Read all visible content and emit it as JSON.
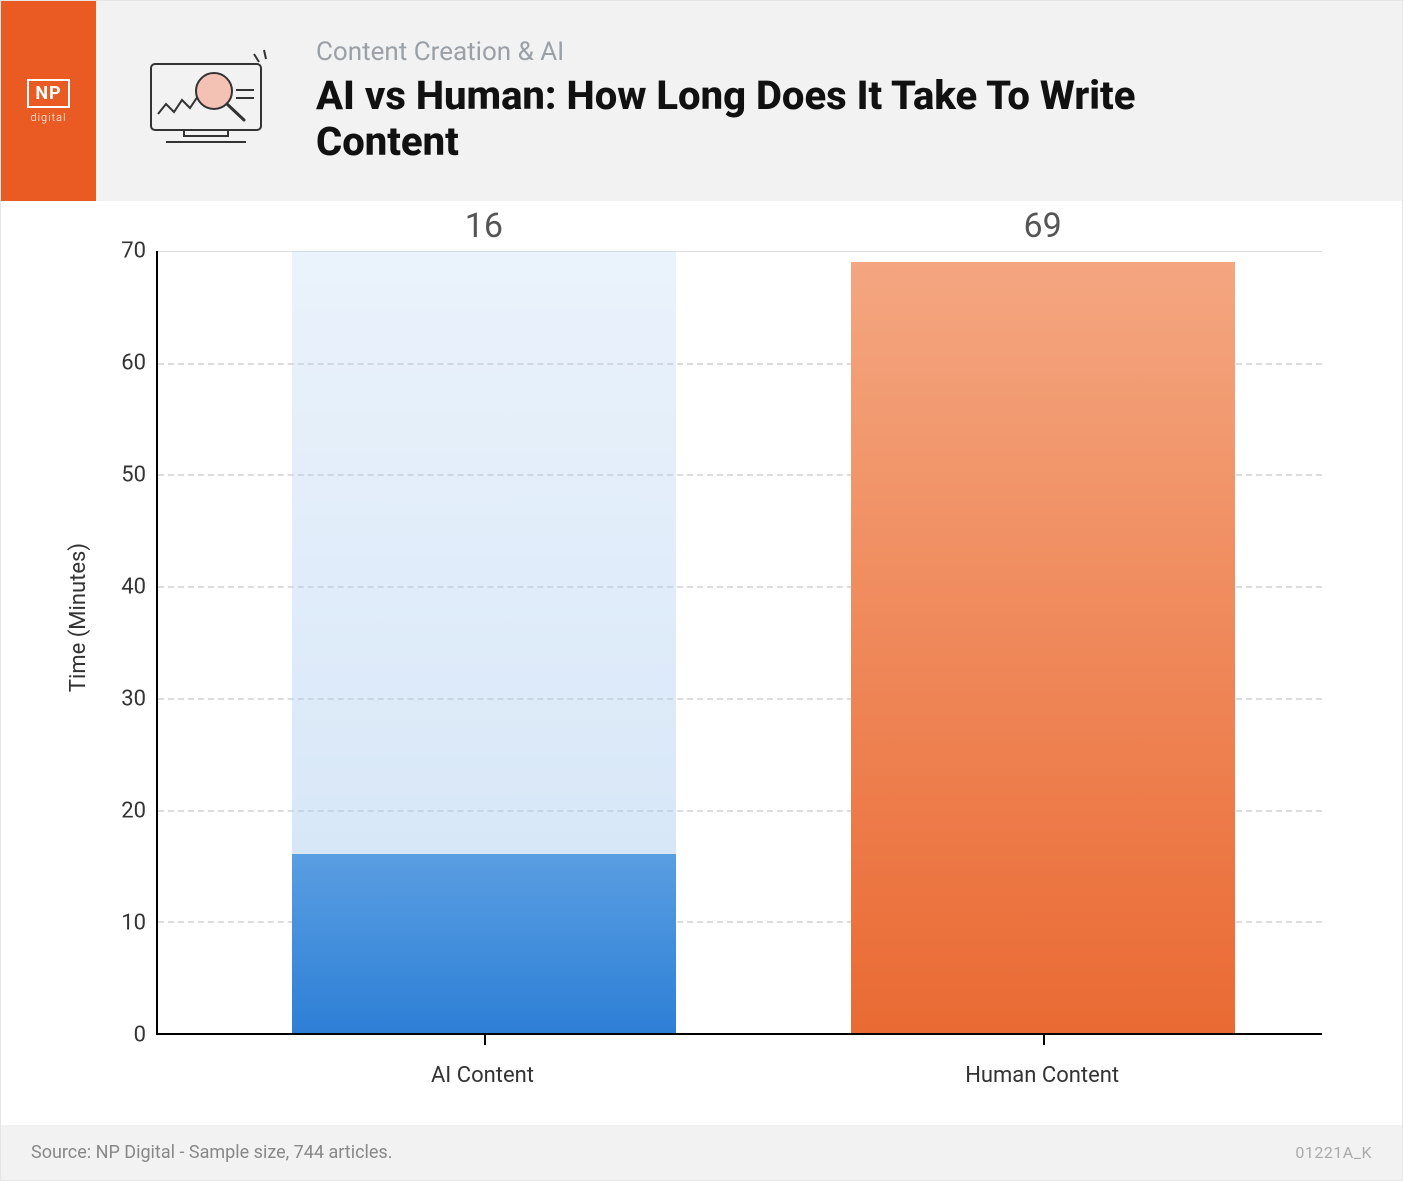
{
  "brand": {
    "name": "NP",
    "sub": "digital"
  },
  "header": {
    "eyebrow": "Content Creation & AI",
    "title": "AI vs Human: How Long Does It Take To Write Content"
  },
  "chart_data": {
    "type": "bar",
    "categories": [
      "AI Content",
      "Human Content"
    ],
    "values": [
      16,
      69
    ],
    "title": "AI vs Human: How Long Does It Take To Write Content",
    "xlabel": "",
    "ylabel": "Time (Minutes)",
    "ylim": [
      0,
      70
    ],
    "yticks": [
      0,
      10,
      20,
      30,
      40,
      50,
      60,
      70
    ],
    "colors": {
      "AI Content": "#2d7fd6",
      "Human Content": "#ea6a33"
    }
  },
  "footer": {
    "source": "Source: NP Digital - Sample size, 744 articles.",
    "code": "01221A_K"
  }
}
